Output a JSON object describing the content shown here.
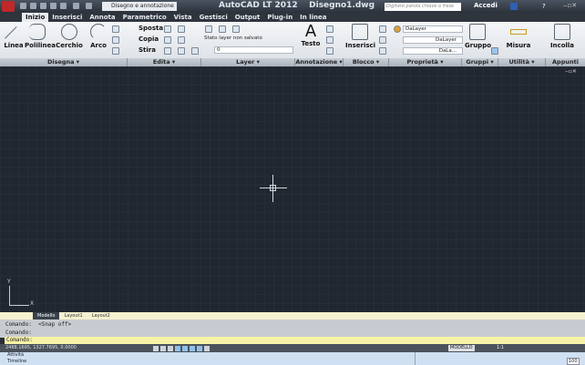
{
  "titlebar": {
    "title": "AutoCAD LT 2012    Disegno1.dwg",
    "workspace": "Disegno e annotazione",
    "search_placeholder": "Digitare parola chiave o frase",
    "login": "Accedi"
  },
  "tabs": [
    "Inizio",
    "Inserisci",
    "Annota",
    "Parametrico",
    "Vista",
    "Gestisci",
    "Output",
    "Plug-in",
    "In linea"
  ],
  "ribbon": {
    "draw": {
      "line": "Linea",
      "polyline": "Polilinea",
      "circle": "Cerchio",
      "arc": "Arco"
    },
    "modify": {
      "move": "Sposta",
      "copy": "Copia",
      "stretch": "Stira"
    },
    "layer": {
      "state": "Stato layer non salvato",
      "current": "0"
    },
    "annotation": {
      "text": "Testo"
    },
    "block": {
      "insert": "Inserisci"
    },
    "properties": {
      "color": "DaLayer",
      "linetype": "DaLayer",
      "lineweight": "DaLa..."
    },
    "groups": {
      "group": "Gruppo"
    },
    "utilities": {
      "measure": "Misura"
    },
    "clipboard": {
      "paste": "Incolla"
    },
    "group_labels": [
      "Disegna ▾",
      "Edita ▾",
      "Layer ▾",
      "Annotazione ▾",
      "Blocco ▾",
      "Proprietà ▾",
      "Gruppi ▾",
      "Utilità ▾",
      "Appunti"
    ]
  },
  "canvas": {
    "ucs_x": "X",
    "ucs_y": "Y"
  },
  "layout_tabs": [
    "Modello",
    "Layout1",
    "Layout2"
  ],
  "command": {
    "lines": [
      "Comando:  <Snap off>",
      "Comando:"
    ],
    "prompt": "Comando:"
  },
  "status": {
    "coords": "2488.1695, 1327.7695, 0.0000",
    "space": "MODELLO",
    "scale": "1:1"
  },
  "taskbar": {
    "items": [
      "Attività",
      "Timeline"
    ],
    "zoom": "100"
  }
}
